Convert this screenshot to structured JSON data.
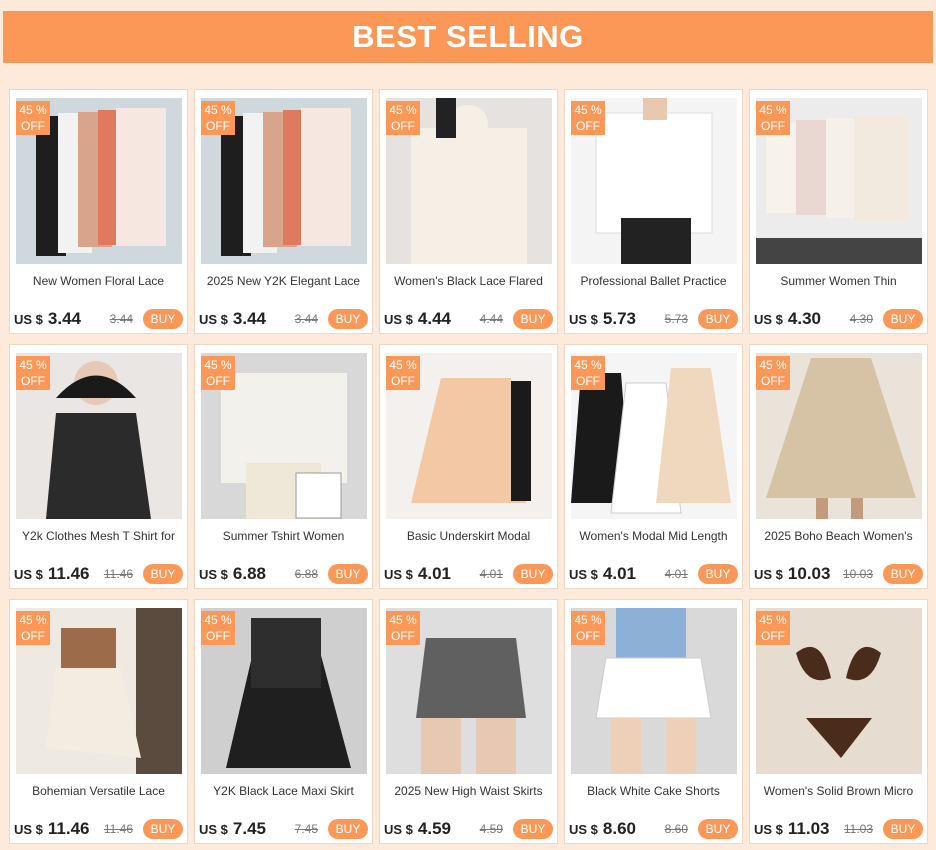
{
  "header": {
    "title": "BEST SELLING"
  },
  "badge": {
    "line1": "45 %",
    "line2": "OFF"
  },
  "currency": "US $",
  "buy_label": "BUY",
  "products": [
    {
      "title": "New Women Floral Lace",
      "price": "3.44",
      "old_price": "3.44",
      "image": "lace-tops"
    },
    {
      "title": "2025 New Y2K Elegant Lace",
      "price": "3.44",
      "old_price": "3.44",
      "image": "lace-tops"
    },
    {
      "title": "Women's Black Lace Flared",
      "price": "4.44",
      "old_price": "4.44",
      "image": "white-lace-top"
    },
    {
      "title": "Professional Ballet Practice",
      "price": "5.73",
      "old_price": "5.73",
      "image": "white-top"
    },
    {
      "title": "Summer Women Thin",
      "price": "4.30",
      "old_price": "4.30",
      "image": "cardigans"
    },
    {
      "title": "Y2k Clothes Mesh T Shirt for",
      "price": "11.46",
      "old_price": "11.46",
      "image": "black-mesh-top"
    },
    {
      "title": "Summer Tshirt Women",
      "price": "6.88",
      "old_price": "6.88",
      "image": "white-mesh-top"
    },
    {
      "title": "Basic Underskirt Modal",
      "price": "4.01",
      "old_price": "4.01",
      "image": "underskirts"
    },
    {
      "title": "Women's Modal Mid Length",
      "price": "4.01",
      "old_price": "4.01",
      "image": "long-underskirts"
    },
    {
      "title": "2025 Boho Beach Women's",
      "price": "10.03",
      "old_price": "10.03",
      "image": "beige-maxi-skirt"
    },
    {
      "title": "Bohemian Versatile Lace",
      "price": "11.46",
      "old_price": "11.46",
      "image": "lace-skirt"
    },
    {
      "title": "Y2K Black Lace Maxi Skirt",
      "price": "7.45",
      "old_price": "7.45",
      "image": "black-lace-skirt"
    },
    {
      "title": "2025 New High Waist Skirts",
      "price": "4.59",
      "old_price": "4.59",
      "image": "grey-mini-skirt"
    },
    {
      "title": "Black White Cake Shorts",
      "price": "8.60",
      "old_price": "8.60",
      "image": "lace-shorts"
    },
    {
      "title": "Women's Solid Brown Micro",
      "price": "11.03",
      "old_price": "11.03",
      "image": "brown-bikini"
    }
  ]
}
